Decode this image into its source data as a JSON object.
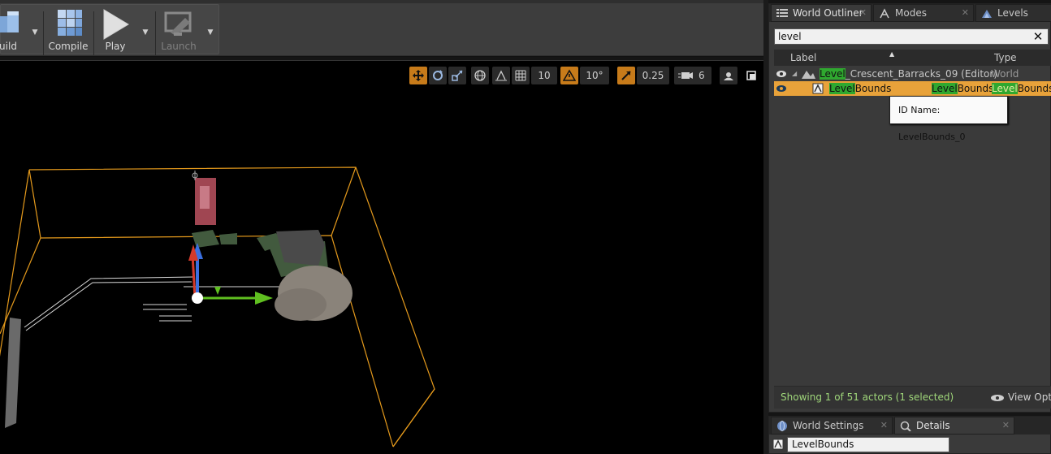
{
  "toolbar": {
    "build_label": "uild",
    "compile_label": "Compile",
    "play_label": "Play",
    "launch_label": "Launch"
  },
  "viewport_tools": {
    "grid_snap": "10",
    "rotation_snap": "10°",
    "scale_snap": "0.25",
    "camera_speed": "6"
  },
  "outliner": {
    "tabs": [
      {
        "label": "World Outliner",
        "icon": "list-icon"
      },
      {
        "label": "Modes",
        "icon": "modes-icon"
      },
      {
        "label": "Levels",
        "icon": "levels-icon"
      }
    ],
    "search_value": "level",
    "columns": {
      "label": "Label",
      "type": "Type"
    },
    "rows": [
      {
        "label_match": "Level",
        "label_rest": "_Crescent_Barracks_09 (Editor)",
        "type": "World"
      },
      {
        "label_match": "Level",
        "label_rest": "Bounds",
        "type_match": "Level",
        "type_rest": "Bounds",
        "type2_match": "Level",
        "type2_rest": "Bounds"
      }
    ],
    "tooltip": "ID Name: LevelBounds_0",
    "status_text": "Showing 1 of 51 actors (1 selected)",
    "view_options_label": "View Options"
  },
  "details": {
    "tabs": [
      {
        "label": "World Settings",
        "icon": "globe-icon"
      },
      {
        "label": "Details",
        "icon": "info-icon"
      }
    ],
    "name_value": "LevelBounds"
  },
  "colors": {
    "selection": "#e8a23a",
    "filter_highlight": "#2fa82f",
    "bounds_box": "#e59a1c",
    "active_tool": "#c77b1a"
  }
}
